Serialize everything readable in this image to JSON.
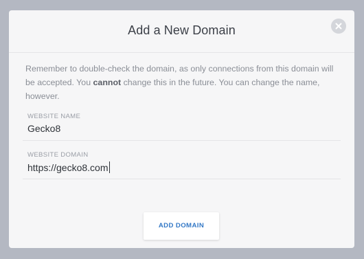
{
  "modal": {
    "title": "Add a New Domain",
    "notice": {
      "before": "Remember to double-check the domain, as only connections from this domain will be accepted. You ",
      "emphasis": "cannot",
      "after": " change this in the future. You can change the name, however."
    },
    "close_icon": "close-icon"
  },
  "form": {
    "website_name": {
      "label": "WEBSITE NAME",
      "value": "Gecko8"
    },
    "website_domain": {
      "label": "WEBSITE DOMAIN",
      "value": "https://gecko8.com"
    }
  },
  "actions": {
    "add_domain_label": "ADD DOMAIN"
  },
  "colors": {
    "backdrop": "#b4b8c2",
    "modal_bg": "#f6f6f7",
    "accent": "#3378c6"
  }
}
